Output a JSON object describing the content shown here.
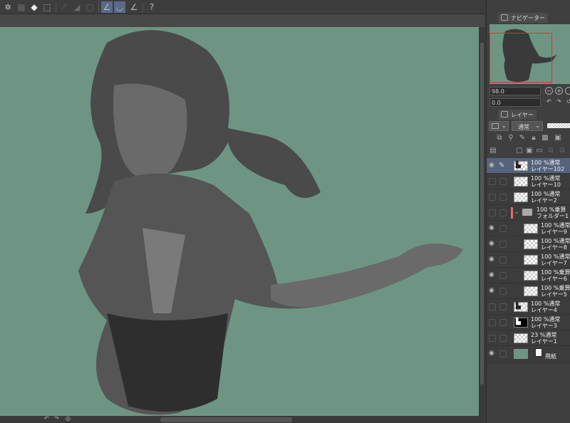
{
  "toolbar": {
    "icons": [
      "selection-ring-icon",
      "select-layer-icon",
      "fill-bucket-icon",
      "transform-icon",
      "ruler-off-icon",
      "gradient-icon",
      "frame-icon",
      "snap-ruler-icon",
      "snap-curve-icon",
      "perspective-ruler-icon",
      "help-icon"
    ]
  },
  "colors": {
    "canvas": "#6e9584",
    "selection": "#56637d",
    "nav_frame": "#e03030"
  },
  "navigator": {
    "tab": "ナビゲーター",
    "zoom": "98.0",
    "rotation": "0.0"
  },
  "layers": {
    "tab": "レイヤー",
    "blend_mode": "通常",
    "items": [
      {
        "opacity": "100 %",
        "mode": "通常",
        "name": "レイヤー102",
        "visible": true,
        "selected": true,
        "thumb": "figure"
      },
      {
        "opacity": "100 %",
        "mode": "通常",
        "name": "レイヤー10",
        "visible": false
      },
      {
        "opacity": "100 %",
        "mode": "通常",
        "name": "レイヤー2",
        "visible": false
      },
      {
        "opacity": "100 %",
        "mode": "乗算",
        "name": "フォルダー1",
        "visible": false,
        "folder": true
      },
      {
        "opacity": "100 %",
        "mode": "通常",
        "name": "レイヤー9",
        "visible": true,
        "indent": true
      },
      {
        "opacity": "100 %",
        "mode": "通常",
        "name": "レイヤー8",
        "visible": true,
        "indent": true
      },
      {
        "opacity": "100 %",
        "mode": "通常",
        "name": "レイヤー7",
        "visible": true,
        "indent": true
      },
      {
        "opacity": "100 %",
        "mode": "乗算",
        "name": "レイヤー6",
        "visible": true,
        "indent": true
      },
      {
        "opacity": "100 %",
        "mode": "乗算",
        "name": "レイヤー5",
        "visible": true,
        "indent": true
      },
      {
        "opacity": "100 %",
        "mode": "通常",
        "name": "レイヤー4",
        "visible": false,
        "thumb": "figure"
      },
      {
        "opacity": "100 %",
        "mode": "通常",
        "name": "レイヤー3",
        "visible": false,
        "thumb": "black"
      },
      {
        "opacity": "23 %",
        "mode": "通常",
        "name": "レイヤー1",
        "visible": false
      },
      {
        "opacity": "",
        "mode": "",
        "name": "用紙",
        "visible": true,
        "paper": true
      }
    ]
  }
}
